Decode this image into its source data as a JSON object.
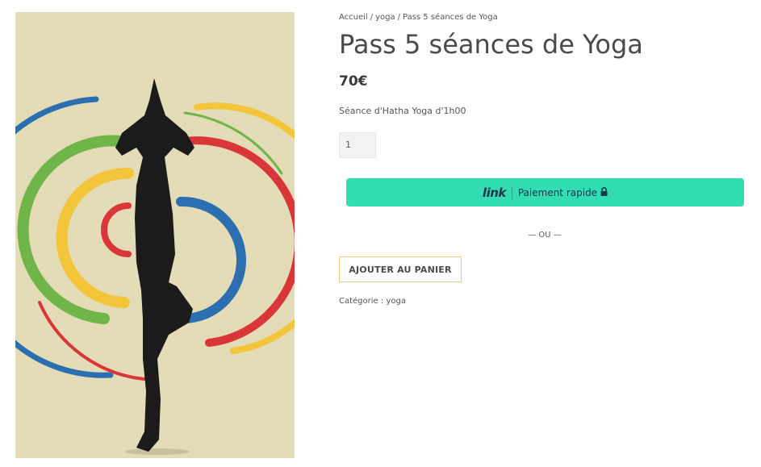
{
  "breadcrumb": {
    "items": [
      "Accueil",
      "yoga",
      "Pass 5 séances de Yoga"
    ],
    "separator": "/"
  },
  "product": {
    "title": "Pass 5 séances de Yoga",
    "price": "70€",
    "description": "Séance d'Hatha Yoga d'1h00",
    "quantity": "1",
    "image_alt": "yoga tree pose silhouette with colored circles"
  },
  "payment": {
    "link_logo": "link",
    "link_label": "Paiement rapide",
    "or_text": "— OU —",
    "add_to_cart": "AJOUTER AU PANIER"
  },
  "meta": {
    "category_label": "Catégorie :",
    "category_value": "yoga"
  },
  "colors": {
    "link_bg": "#33ddb3",
    "link_text": "#1d3944",
    "cart_border": "#e7c97c",
    "image_bg": "#e3dcb6",
    "ring_blue": "#2b6fb0",
    "ring_green": "#6fb54a",
    "ring_yellow": "#f2c53a",
    "ring_red": "#d9363a"
  }
}
